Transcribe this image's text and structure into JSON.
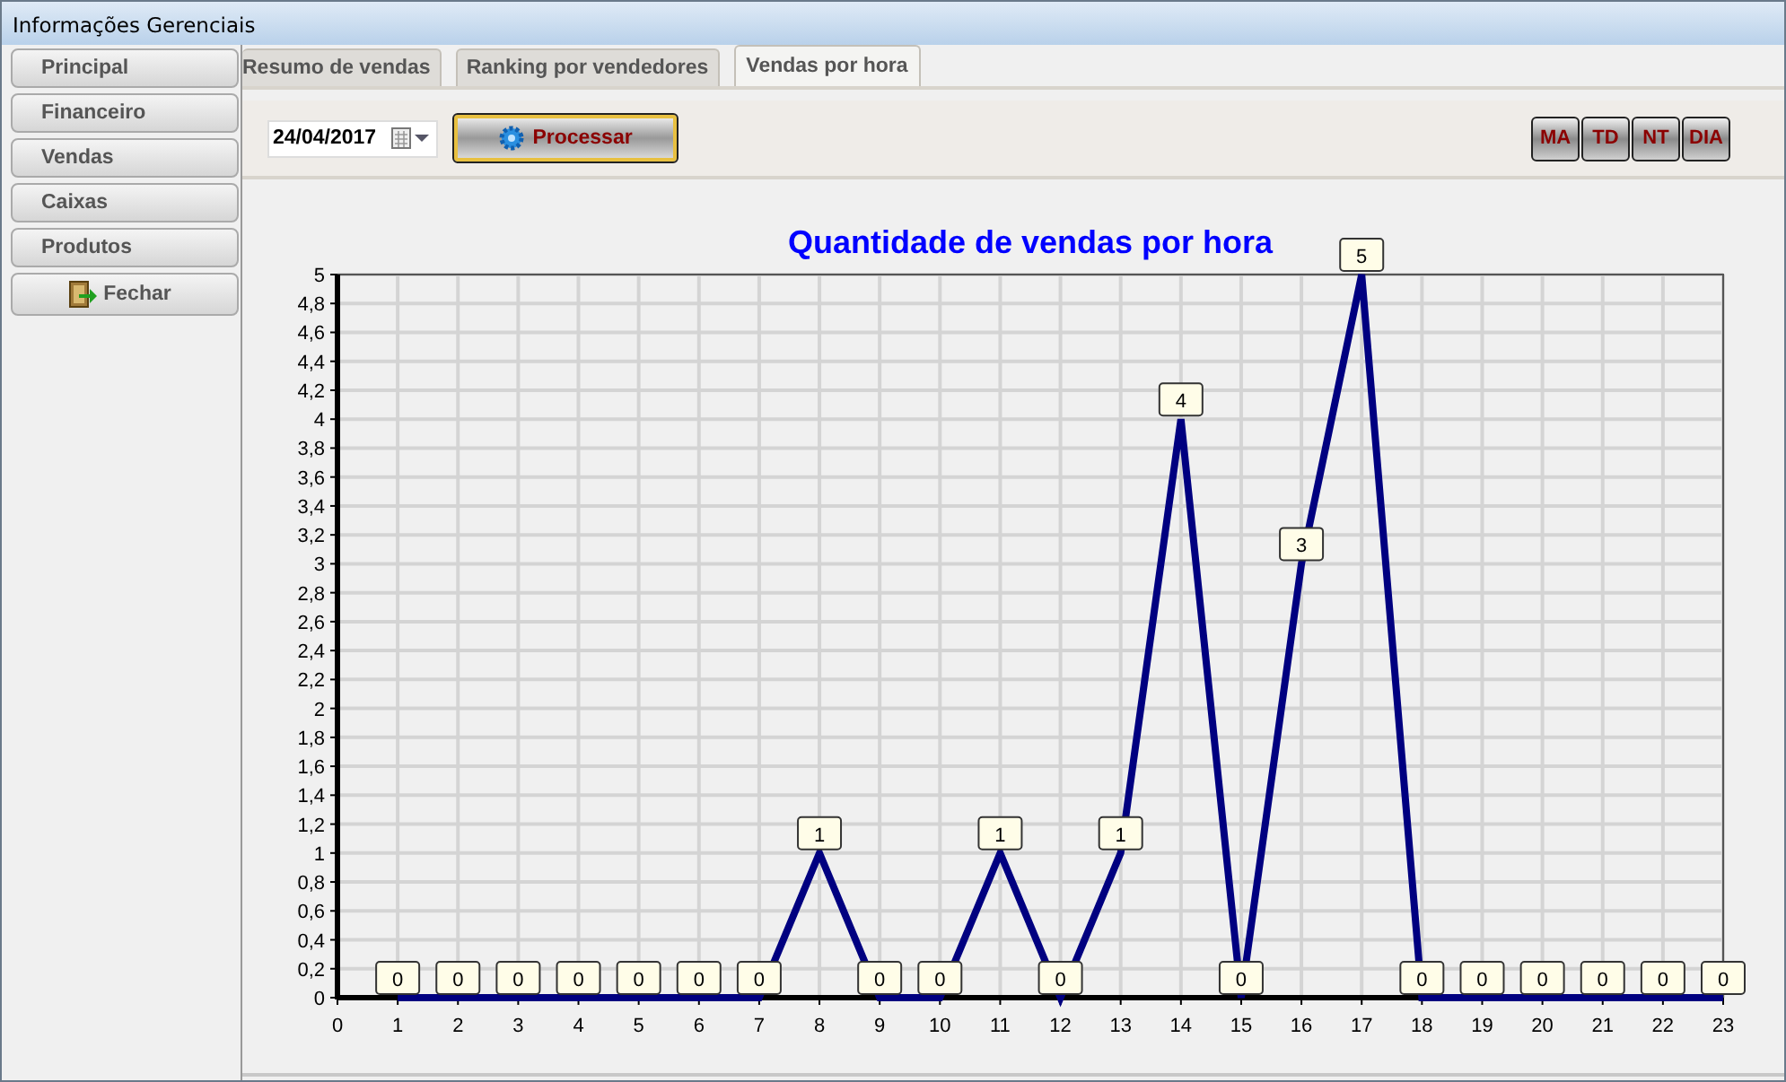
{
  "window": {
    "title": "Informações Gerenciais"
  },
  "sidebar": {
    "items": [
      {
        "label": "Principal"
      },
      {
        "label": "Financeiro"
      },
      {
        "label": "Vendas"
      },
      {
        "label": "Caixas"
      },
      {
        "label": "Produtos"
      },
      {
        "label": "Fechar",
        "kind": "close"
      }
    ]
  },
  "tabs": [
    {
      "label": "Resumo de vendas",
      "selected": false
    },
    {
      "label": "Ranking por vendedores",
      "selected": false
    },
    {
      "label": "Vendas por hora",
      "selected": true
    }
  ],
  "toolbar": {
    "date": "24/04/2017",
    "process_button": "Processar",
    "period_buttons": [
      "MA",
      "TD",
      "NT",
      "DIA"
    ]
  },
  "chart_data": {
    "type": "line",
    "title": "Quantidade de vendas por hora",
    "x": [
      1,
      2,
      3,
      4,
      5,
      6,
      7,
      8,
      9,
      10,
      11,
      12,
      13,
      14,
      15,
      16,
      17,
      18,
      19,
      20,
      21,
      22,
      23
    ],
    "grid": true,
    "series": [
      {
        "color": "#000080",
        "values": [
          0,
          0,
          0,
          0,
          0,
          0,
          0,
          1,
          0,
          0,
          1,
          0,
          1,
          4,
          0,
          3,
          5,
          0,
          0,
          0,
          0,
          0,
          0
        ]
      }
    ],
    "xlim": [
      0,
      23
    ],
    "ylim": [
      0,
      5
    ],
    "xticks": [
      0,
      1,
      2,
      3,
      4,
      5,
      6,
      7,
      8,
      9,
      10,
      11,
      12,
      13,
      14,
      15,
      16,
      17,
      18,
      19,
      20,
      21,
      22,
      23
    ],
    "yticks": [
      0,
      {
        "value": 0.2,
        "label": "0,2"
      },
      {
        "value": 0.4,
        "label": "0,4"
      },
      {
        "value": 0.6,
        "label": "0,6"
      },
      {
        "value": 0.8,
        "label": "0,8"
      },
      1,
      {
        "value": 1.2,
        "label": "1,2"
      },
      {
        "value": 1.4,
        "label": "1,4"
      },
      {
        "value": 1.6,
        "label": "1,6"
      },
      {
        "value": 1.8,
        "label": "1,8"
      },
      2,
      {
        "value": 2.2,
        "label": "2,2"
      },
      {
        "value": 2.4,
        "label": "2,4"
      },
      {
        "value": 2.6,
        "label": "2,6"
      },
      {
        "value": 2.8,
        "label": "2,8"
      },
      3,
      {
        "value": 3.2,
        "label": "3,2"
      },
      {
        "value": 3.4,
        "label": "3,4"
      },
      {
        "value": 3.6,
        "label": "3,6"
      },
      {
        "value": 3.8,
        "label": "3,8"
      },
      4,
      {
        "value": 4.2,
        "label": "4,2"
      },
      {
        "value": 4.4,
        "label": "4,4"
      },
      {
        "value": 4.6,
        "label": "4,6"
      },
      {
        "value": 4.8,
        "label": "4,8"
      },
      5
    ],
    "data_labels": true
  }
}
